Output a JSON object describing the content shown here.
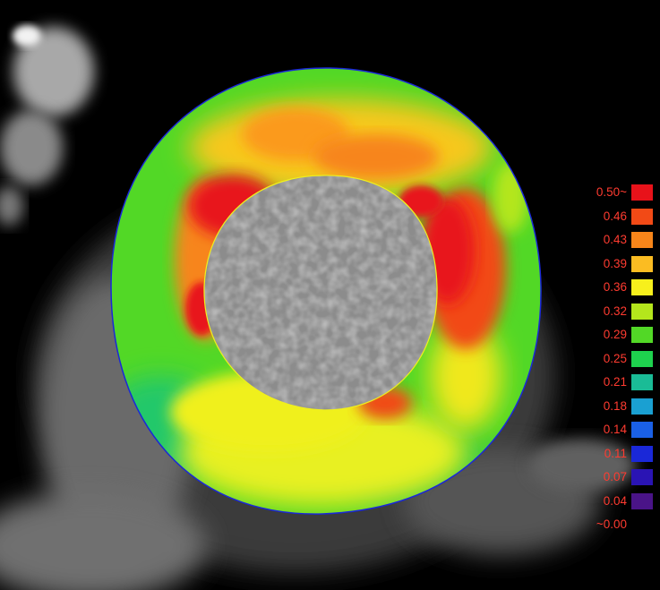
{
  "colormap_legend": {
    "entries": [
      {
        "label": "0.50~",
        "color": "#e8121a"
      },
      {
        "label": "0.46",
        "color": "#f24a16"
      },
      {
        "label": "0.43",
        "color": "#f7851a"
      },
      {
        "label": "0.39",
        "color": "#fbbc22"
      },
      {
        "label": "0.36",
        "color": "#f7f01c"
      },
      {
        "label": "0.32",
        "color": "#b4e61c"
      },
      {
        "label": "0.29",
        "color": "#52d826"
      },
      {
        "label": "0.25",
        "color": "#1ed24e"
      },
      {
        "label": "0.21",
        "color": "#1abc96"
      },
      {
        "label": "0.18",
        "color": "#1aa0d2"
      },
      {
        "label": "0.14",
        "color": "#1a60e6"
      },
      {
        "label": "0.11",
        "color": "#1a28d8"
      },
      {
        "label": "0.07",
        "color": "#2a14b4"
      },
      {
        "label": "0.04",
        "color": "#4a1488"
      },
      {
        "label": "~0.00",
        "color": "#000000"
      }
    ]
  },
  "image": {
    "background_color": "#000000",
    "myocardium_base_color": "#52d826",
    "high_value_color": "#e8121a",
    "cavity_color": "#8c8c8c"
  }
}
